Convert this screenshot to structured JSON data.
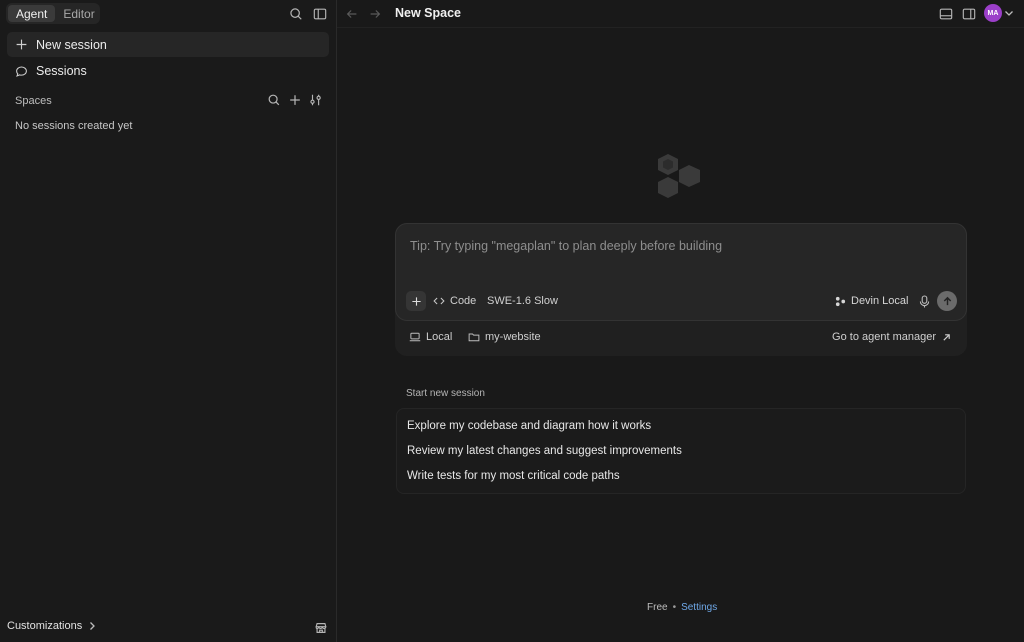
{
  "sidebar": {
    "mode_tabs": [
      {
        "label": "Agent",
        "active": true
      },
      {
        "label": "Editor",
        "active": false
      }
    ],
    "new_session_label": "New session",
    "sessions_label": "Sessions",
    "spaces_label": "Spaces",
    "empty_message": "No sessions created yet",
    "customizations_label": "Customizations"
  },
  "header": {
    "title": "New Space",
    "avatar_initials": "MA",
    "avatar_color": "#9b3fc9"
  },
  "composer": {
    "placeholder": "Tip: Try typing \"megaplan\" to plan deeply before building",
    "mode_label": "Code",
    "model_label": "SWE-1.6 Slow",
    "agent_label": "Devin Local",
    "env_label": "Local",
    "repo_label": "my-website",
    "agent_manager_label": "Go to agent manager"
  },
  "start": {
    "label": "Start new session",
    "suggestions": [
      "Explore my codebase and diagram how it works",
      "Review my latest changes and suggest improvements",
      "Write tests for my most critical code paths"
    ]
  },
  "footer": {
    "plan_label": "Free",
    "separator": "•",
    "settings_label": "Settings"
  },
  "colors": {
    "background": "#191919",
    "accent_link": "#6fa8e8"
  }
}
